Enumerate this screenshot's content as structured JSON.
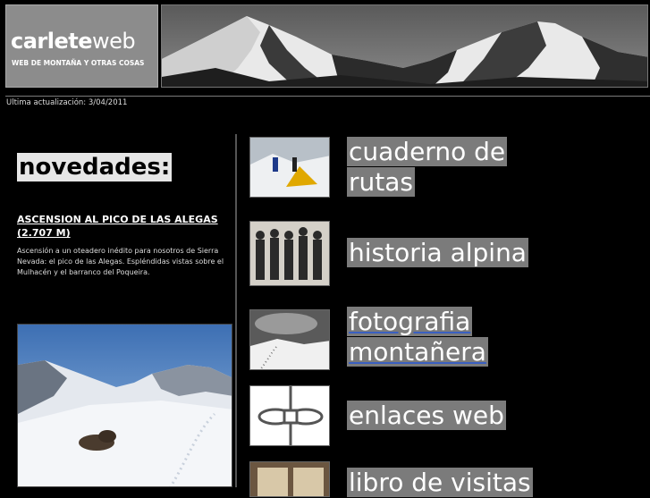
{
  "header": {
    "logo_title_bold": "carlete",
    "logo_title_thin": "web",
    "logo_subtitle": "WEB DE MONTAÑA Y OTRAS COSAS",
    "last_update": "Ultima actualización: 3/04/2011"
  },
  "news": {
    "heading": "novedades:",
    "link_title": "ASCENSION AL PICO DE LAS ALEGAS (2.707 M)",
    "description": "Ascensión a un oteadero inédito para nosotros de Sierra Nevada: el pico de las Alegas. Espléndidas vistas sobre el Mulhacén y el barranco del Poqueira."
  },
  "sections": [
    {
      "label_line1": "cuaderno de",
      "label_line2": "rutas",
      "thumb_icon": "tent-snow-photo"
    },
    {
      "label_line1": "historia alpina",
      "thumb_icon": "alpinists-historic-photo"
    },
    {
      "label_line1": "fotografia",
      "label_line2": "montañera",
      "thumb_icon": "snowy-slope-photo"
    },
    {
      "label_line1": "enlaces web",
      "thumb_icon": "rope-knot-icon"
    },
    {
      "label_line1": "libro de visitas",
      "thumb_icon": "guestbook-photo"
    }
  ]
}
